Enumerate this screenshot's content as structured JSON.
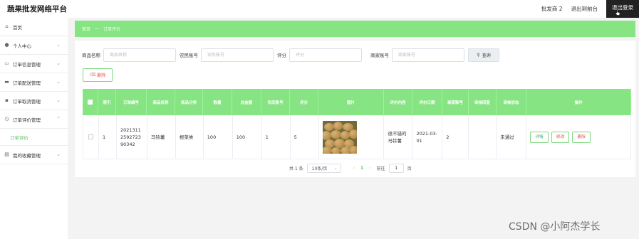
{
  "app": {
    "title": "蔬果批发网络平台"
  },
  "topbar": {
    "user": "批发商 2",
    "front_link": "退出到前台",
    "logout": "退出登录"
  },
  "sidebar": {
    "items": [
      {
        "label": "首页",
        "icon": "home-icon"
      },
      {
        "label": "个人中心",
        "icon": "user-icon"
      },
      {
        "label": "订单信息管理",
        "icon": "order-icon"
      },
      {
        "label": "订单配送管理",
        "icon": "truck-icon"
      },
      {
        "label": "订单取消管理",
        "icon": "cancel-icon"
      },
      {
        "label": "订单评价管理",
        "icon": "review-icon"
      },
      {
        "label": "订单评价"
      },
      {
        "label": "我的收藏管理",
        "icon": "favorite-icon"
      }
    ]
  },
  "breadcrumb": {
    "home": "首页",
    "sep": "—",
    "current": "订单评价"
  },
  "search": {
    "fields": [
      {
        "label": "商品名称",
        "placeholder": "商品名称"
      },
      {
        "label": "农民账号",
        "placeholder": "农民账号"
      },
      {
        "label": "评分",
        "placeholder": "评分"
      },
      {
        "label": "商家账号",
        "placeholder": "商家账号"
      }
    ],
    "button": "查询"
  },
  "toolbar": {
    "delete": "删除"
  },
  "table": {
    "headers": [
      "",
      "索引",
      "订单编号",
      "商品名称",
      "商品分类",
      "数量",
      "总金额",
      "农民账号",
      "评分",
      "图片",
      "评价内容",
      "评价日期",
      "商家账号",
      "审核回复",
      "审核状态",
      "操作"
    ],
    "rows": [
      {
        "index": "1",
        "order_no": "2021311 2592723 90342",
        "name": "马铃薯",
        "category": "根菜类",
        "qty": "100",
        "total": "100",
        "farmer": "1",
        "score": "5",
        "content": "很不错的 马铃薯",
        "date": "2021-03- 01",
        "merchant": "2",
        "reply": "",
        "status": "未通过",
        "ops": [
          "详情",
          "修改",
          "删除"
        ]
      }
    ]
  },
  "pager": {
    "total": "共 1 条",
    "size": "10条/页",
    "page": "1",
    "goto_label": "前往",
    "goto_value": "1",
    "page_suffix": "页"
  },
  "watermark": "CSDN @小阿杰学长",
  "colors": {
    "accent": "#86e582",
    "danger": "#dd5555"
  }
}
